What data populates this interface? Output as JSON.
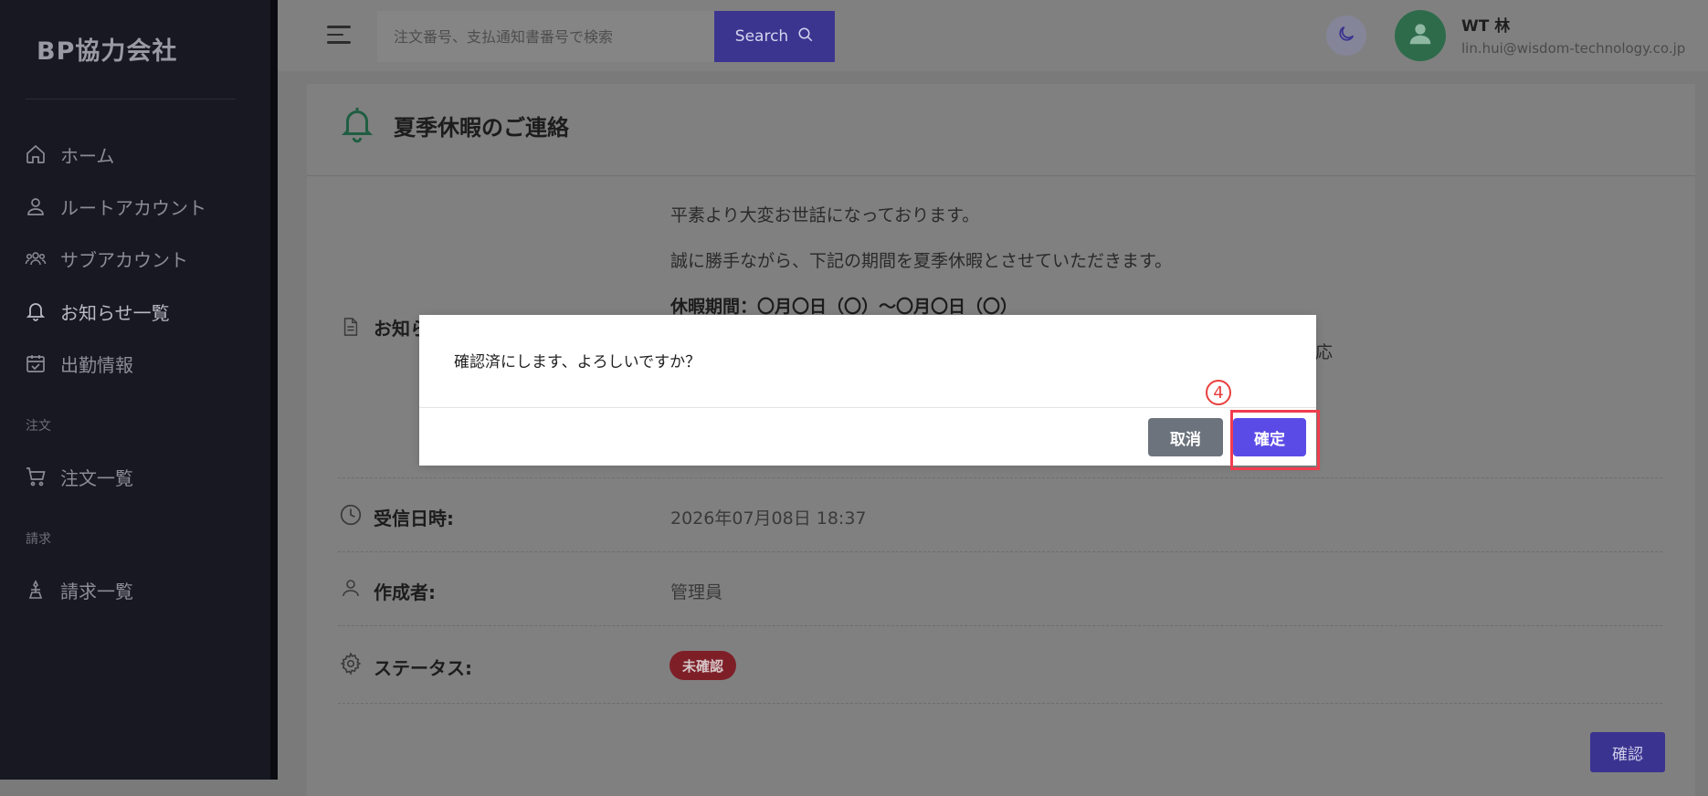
{
  "brand": "BP協力会社",
  "sidebar": {
    "items": [
      {
        "label": "ホーム",
        "icon": "home-icon"
      },
      {
        "label": "ルートアカウント",
        "icon": "user-icon"
      },
      {
        "label": "サブアカウント",
        "icon": "users-icon"
      },
      {
        "label": "お知らせ一覧",
        "icon": "bell-icon"
      },
      {
        "label": "出勤情報",
        "icon": "calendar-check-icon"
      },
      {
        "label": "注文一覧",
        "icon": "cart-icon"
      },
      {
        "label": "請求一覧",
        "icon": "invoice-icon"
      }
    ],
    "sections": {
      "order": "注文",
      "invoice": "請求"
    }
  },
  "header": {
    "search_placeholder": "注文番号、支払通知書番号で検索",
    "search_button": "Search",
    "user_name": "WT 林",
    "user_email": "lin.hui@wisdom-technology.co.jp"
  },
  "notice": {
    "title": "夏季休暇のご連絡",
    "content_label": "お知ら",
    "body": [
      "平素より大変お世話になっております。",
      "誠に勝手ながら、下記の期間を夏季休暇とさせていただきます。",
      "休暇期間：〇月〇日（〇）〜〇月〇日（〇）",
      "応"
    ],
    "received_label": "受信日時:",
    "received_value": "2026年07月08日 18:37",
    "author_label": "作成者:",
    "author_value": "管理員",
    "status_label": "ステータス:",
    "status_value": "未確認",
    "confirm_button": "確認"
  },
  "modal": {
    "message": "確認済にします、よろしいですか？",
    "cancel": "取消",
    "ok": "確定",
    "step_marker": "4"
  },
  "colors": {
    "sidebar_bg": "#171821",
    "accent": "#5b4be6",
    "highlight": "#f03d4d",
    "status_badge": "#7e1f28"
  }
}
